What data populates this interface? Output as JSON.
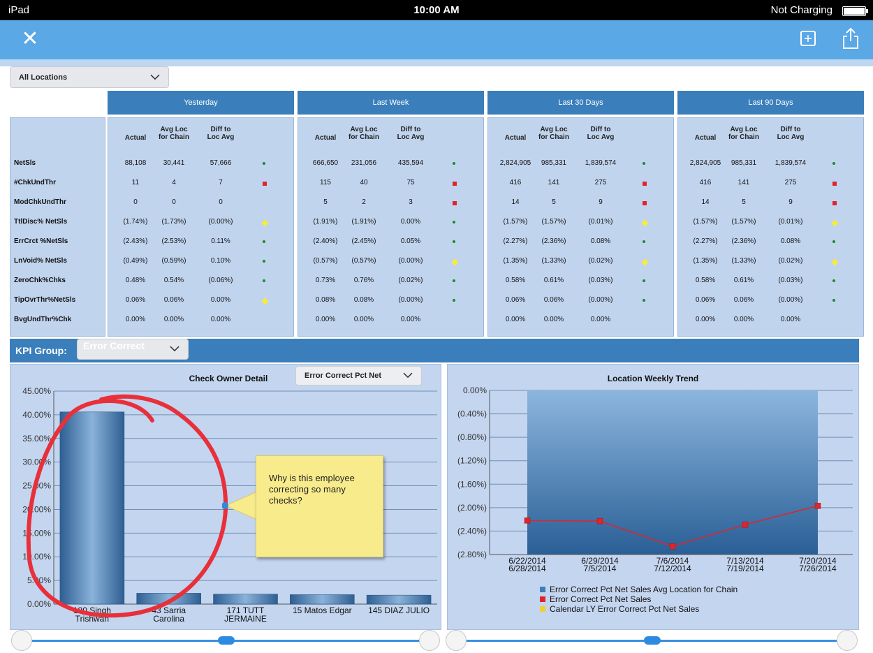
{
  "status_bar": {
    "device": "iPad",
    "time": "10:00 AM",
    "battery_label": "Not Charging"
  },
  "location_filter": {
    "selected": "All Locations"
  },
  "kpi_table": {
    "periods": [
      "Yesterday",
      "Last Week",
      "Last 30 Days",
      "Last 90 Days"
    ],
    "column_headers": {
      "actual": "Actual",
      "avg_1": "Avg Loc",
      "avg_2": "for Chain",
      "diff_1": "Diff to",
      "diff_2": "Loc Avg"
    },
    "rows": [
      {
        "label": "NetSls",
        "periods": [
          {
            "actual": "88,108",
            "avg": "30,441",
            "diff": "57,666",
            "status": "green"
          },
          {
            "actual": "666,650",
            "avg": "231,056",
            "diff": "435,594",
            "status": "green"
          },
          {
            "actual": "2,824,905",
            "avg": "985,331",
            "diff": "1,839,574",
            "status": "green"
          },
          {
            "actual": "2,824,905",
            "avg": "985,331",
            "diff": "1,839,574",
            "status": "green"
          }
        ]
      },
      {
        "label": "#ChkUndThr",
        "periods": [
          {
            "actual": "11",
            "avg": "4",
            "diff": "7",
            "status": "red"
          },
          {
            "actual": "115",
            "avg": "40",
            "diff": "75",
            "status": "red"
          },
          {
            "actual": "416",
            "avg": "141",
            "diff": "275",
            "status": "red"
          },
          {
            "actual": "416",
            "avg": "141",
            "diff": "275",
            "status": "red"
          }
        ]
      },
      {
        "label": "ModChkUndThr",
        "periods": [
          {
            "actual": "0",
            "avg": "0",
            "diff": "0",
            "status": ""
          },
          {
            "actual": "5",
            "avg": "2",
            "diff": "3",
            "status": "red"
          },
          {
            "actual": "14",
            "avg": "5",
            "diff": "9",
            "status": "red"
          },
          {
            "actual": "14",
            "avg": "5",
            "diff": "9",
            "status": "red"
          }
        ]
      },
      {
        "label": "TtlDisc% NetSls",
        "periods": [
          {
            "actual": "(1.74%)",
            "avg": "(1.73%)",
            "diff": "(0.00%)",
            "status": "yellow"
          },
          {
            "actual": "(1.91%)",
            "avg": "(1.91%)",
            "diff": "0.00%",
            "status": "green"
          },
          {
            "actual": "(1.57%)",
            "avg": "(1.57%)",
            "diff": "(0.01%)",
            "status": "yellow"
          },
          {
            "actual": "(1.57%)",
            "avg": "(1.57%)",
            "diff": "(0.01%)",
            "status": "yellow"
          }
        ]
      },
      {
        "label": "ErrCrct %NetSls",
        "periods": [
          {
            "actual": "(2.43%)",
            "avg": "(2.53%)",
            "diff": "0.11%",
            "status": "green"
          },
          {
            "actual": "(2.40%)",
            "avg": "(2.45%)",
            "diff": "0.05%",
            "status": "green"
          },
          {
            "actual": "(2.27%)",
            "avg": "(2.36%)",
            "diff": "0.08%",
            "status": "green"
          },
          {
            "actual": "(2.27%)",
            "avg": "(2.36%)",
            "diff": "0.08%",
            "status": "green"
          }
        ]
      },
      {
        "label": "LnVoid% NetSls",
        "periods": [
          {
            "actual": "(0.49%)",
            "avg": "(0.59%)",
            "diff": "0.10%",
            "status": "green"
          },
          {
            "actual": "(0.57%)",
            "avg": "(0.57%)",
            "diff": "(0.00%)",
            "status": "yellow"
          },
          {
            "actual": "(1.35%)",
            "avg": "(1.33%)",
            "diff": "(0.02%)",
            "status": "yellow"
          },
          {
            "actual": "(1.35%)",
            "avg": "(1.33%)",
            "diff": "(0.02%)",
            "status": "yellow"
          }
        ]
      },
      {
        "label": "ZeroChk%Chks",
        "periods": [
          {
            "actual": "0.48%",
            "avg": "0.54%",
            "diff": "(0.06%)",
            "status": "green"
          },
          {
            "actual": "0.73%",
            "avg": "0.76%",
            "diff": "(0.02%)",
            "status": "green"
          },
          {
            "actual": "0.58%",
            "avg": "0.61%",
            "diff": "(0.03%)",
            "status": "green"
          },
          {
            "actual": "0.58%",
            "avg": "0.61%",
            "diff": "(0.03%)",
            "status": "green"
          }
        ]
      },
      {
        "label": "TipOvrThr%NetSls",
        "periods": [
          {
            "actual": "0.06%",
            "avg": "0.06%",
            "diff": "0.00%",
            "status": "yellow"
          },
          {
            "actual": "0.08%",
            "avg": "0.08%",
            "diff": "(0.00%)",
            "status": "green"
          },
          {
            "actual": "0.06%",
            "avg": "0.06%",
            "diff": "(0.00%)",
            "status": "green"
          },
          {
            "actual": "0.06%",
            "avg": "0.06%",
            "diff": "(0.00%)",
            "status": "green"
          }
        ]
      },
      {
        "label": "BvgUndThr%Chk",
        "periods": [
          {
            "actual": "0.00%",
            "avg": "0.00%",
            "diff": "0.00%",
            "status": ""
          },
          {
            "actual": "0.00%",
            "avg": "0.00%",
            "diff": "0.00%",
            "status": ""
          },
          {
            "actual": "0.00%",
            "avg": "0.00%",
            "diff": "0.00%",
            "status": ""
          },
          {
            "actual": "0.00%",
            "avg": "0.00%",
            "diff": "0.00%",
            "status": ""
          }
        ]
      }
    ]
  },
  "kpi_group": {
    "label": "KPI Group:",
    "selected": "Error Correct"
  },
  "callout": {
    "text": "Why is this employee correcting so many checks?"
  },
  "colors": {
    "accent": "#5aa8e6",
    "header_blue": "#3a7fbb",
    "status_green": "#1a8a2a",
    "status_red": "#e0242a",
    "status_yellow": "#f6ec3a",
    "annotation_red": "#e8303a"
  },
  "chart_data": [
    {
      "type": "bar",
      "title": "Check Owner Detail",
      "metric_selector": "Error Correct Pct Net",
      "categories": [
        [
          "180 Singh",
          "Trishwan"
        ],
        [
          "43 Sarria",
          "Carolina"
        ],
        [
          "171 TUTT",
          "JERMAINE"
        ],
        [
          "15 Matos Edgar"
        ],
        [
          "145 DIAZ JULIO"
        ]
      ],
      "values": [
        40.6,
        2.3,
        2.1,
        2.0,
        1.9
      ],
      "ylim": [
        0,
        45
      ],
      "yticks": [
        "0.00%",
        "5.00%",
        "10.00%",
        "15.00%",
        "20.00%",
        "25.00%",
        "30.00%",
        "35.00%",
        "40.00%",
        "45.00%"
      ],
      "grid": true
    },
    {
      "type": "area",
      "title": "Location Weekly Trend",
      "categories": [
        [
          "6/22/2014",
          "6/28/2014"
        ],
        [
          "6/29/2014",
          "7/5/2014"
        ],
        [
          "7/6/2014",
          "7/12/2014"
        ],
        [
          "7/13/2014",
          "7/19/2014"
        ],
        [
          "7/20/2014",
          "7/26/2014"
        ]
      ],
      "series": [
        {
          "name": "Error Correct Pct Net Sales Avg Location for Chain",
          "kind": "area",
          "values": [
            -2.8,
            -2.8,
            -2.8,
            -2.8,
            -2.8
          ],
          "color": "#3f7fb8"
        },
        {
          "name": "Error Correct Pct Net Sales",
          "kind": "line",
          "values": [
            -2.22,
            -2.23,
            -2.66,
            -2.29,
            -1.97
          ],
          "color": "#e0242a"
        },
        {
          "name": "Calendar LY Error Correct Pct Net Sales",
          "kind": "line",
          "values": [],
          "color": "#f0d030"
        }
      ],
      "ylim": [
        -2.8,
        0
      ],
      "yticks": [
        "0.00%",
        "(0.40%)",
        "(0.80%)",
        "(1.20%)",
        "(1.60%)",
        "(2.00%)",
        "(2.40%)",
        "(2.80%)"
      ],
      "legend": "bottom",
      "grid": true
    }
  ]
}
